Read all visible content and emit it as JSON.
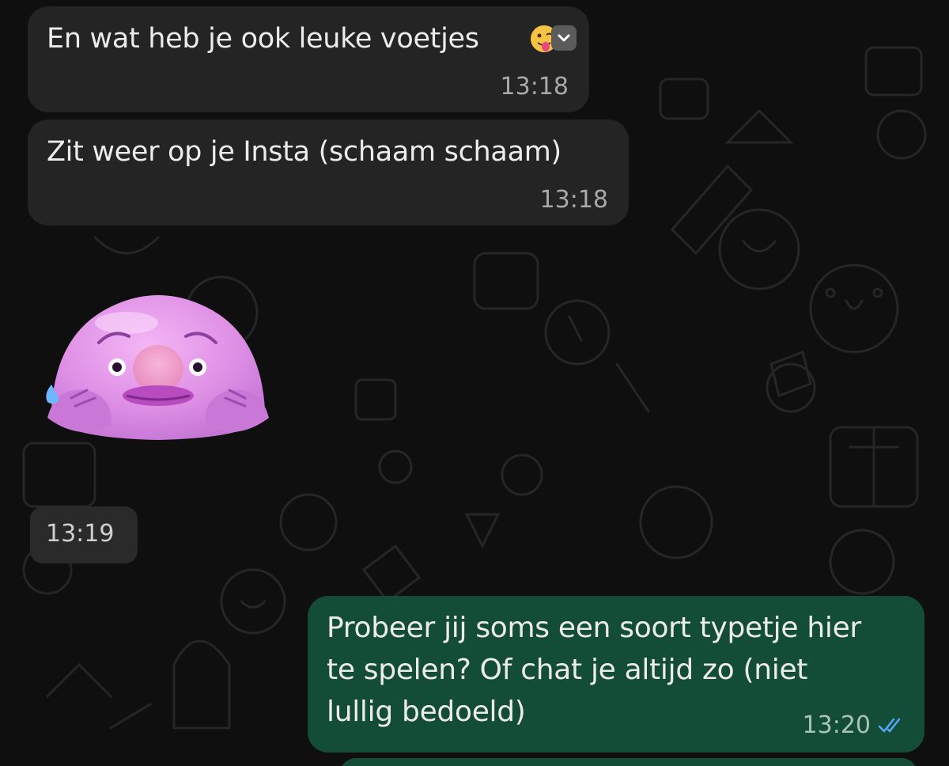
{
  "messages": [
    {
      "direction": "incoming",
      "text": "En wat heb je ook leuke voetjes",
      "emoji": "face-with-tongue",
      "time": "13:18"
    },
    {
      "direction": "incoming",
      "text": "Zit weer op je Insta (schaam schaam)",
      "time": "13:18"
    },
    {
      "direction": "incoming",
      "type": "sticker",
      "sticker": "pink-blobfish-shy",
      "time": "13:19"
    },
    {
      "direction": "outgoing",
      "lines": [
        "Probeer jij soms een soort typetje hier",
        "te spelen? Of chat je altijd zo (niet",
        "lullig bedoeld)"
      ],
      "time": "13:20",
      "status": "read-double-check"
    }
  ],
  "colors": {
    "background": "#0f0f0f",
    "incoming_bubble": "#242424",
    "outgoing_bubble": "#144d37",
    "read_check": "#53a6ff"
  },
  "icons": {
    "dropdown": "chevron-down-icon",
    "read": "double-check-icon"
  }
}
